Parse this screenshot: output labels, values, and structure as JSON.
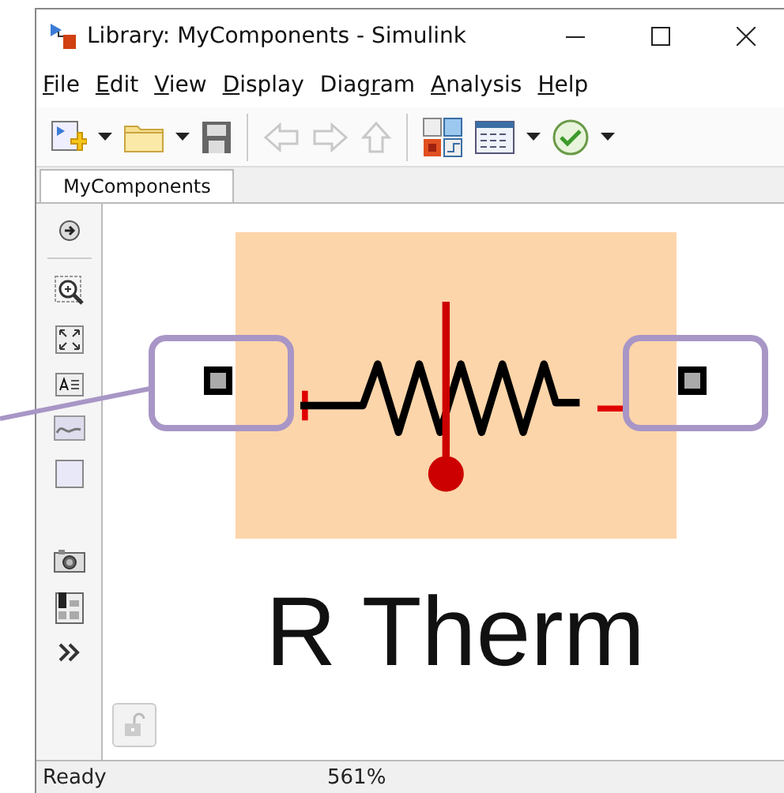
{
  "window": {
    "title": "Library: MyComponents - Simulink"
  },
  "menu": [
    {
      "key": "F",
      "post": "ile"
    },
    {
      "key": "E",
      "post": "dit"
    },
    {
      "key": "V",
      "post": "iew"
    },
    {
      "key": "D",
      "post": "isplay"
    },
    {
      "pre": "Diag",
      "key": "r",
      "post": "am"
    },
    {
      "key": "A",
      "post": "nalysis"
    },
    {
      "key": "H",
      "post": "elp"
    }
  ],
  "toolbar": [
    {
      "kind": "new",
      "disabled": false
    },
    {
      "kind": "caret",
      "disabled": false
    },
    {
      "kind": "open",
      "disabled": false
    },
    {
      "kind": "caret",
      "disabled": false
    },
    {
      "kind": "save",
      "disabled": false
    },
    {
      "kind": "separator"
    },
    {
      "kind": "back",
      "disabled": true
    },
    {
      "kind": "forward",
      "disabled": true
    },
    {
      "kind": "up",
      "disabled": true
    },
    {
      "kind": "separator"
    },
    {
      "kind": "library",
      "disabled": false
    },
    {
      "kind": "explorer",
      "disabled": false
    },
    {
      "kind": "caret",
      "disabled": false
    },
    {
      "kind": "check",
      "disabled": false
    },
    {
      "kind": "caret",
      "disabled": false
    }
  ],
  "tabs": [
    {
      "label": "MyComponents",
      "selected": true
    }
  ],
  "palette": [
    {
      "kind": "navigate"
    },
    {
      "kind": "separator"
    },
    {
      "kind": "zoom"
    },
    {
      "kind": "fit"
    },
    {
      "kind": "text"
    },
    {
      "kind": "image"
    },
    {
      "kind": "area"
    },
    {
      "kind": "gap"
    },
    {
      "kind": "camera"
    },
    {
      "kind": "report"
    },
    {
      "kind": "more"
    }
  ],
  "block": {
    "label": "R Therm"
  },
  "status_bar": {
    "state": "Ready",
    "zoom": "561%"
  }
}
